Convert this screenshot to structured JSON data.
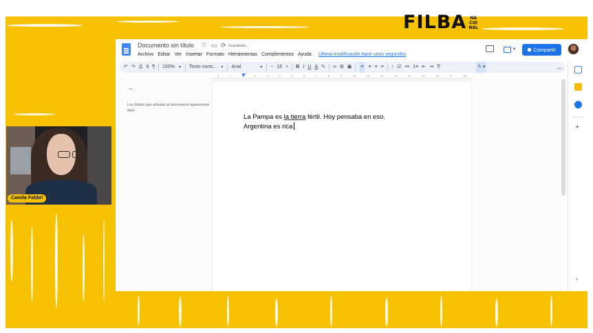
{
  "logo": {
    "main": "FILBA",
    "sub_lines": [
      "NA",
      "CIO",
      "NAL"
    ]
  },
  "docs": {
    "title": "Documento sin título",
    "saving_status": "Guardando...",
    "menu": [
      "Archivo",
      "Editar",
      "Ver",
      "Insertar",
      "Formato",
      "Herramientas",
      "Complementos",
      "Ayuda"
    ],
    "last_edit": "Última modificación hace unos segundos",
    "share_label": "Compartir",
    "toolbar": {
      "zoom": "100%",
      "style": "Texto norm...",
      "font": "Arial",
      "minus": "−",
      "font_size": "16",
      "plus": "+",
      "bold": "B",
      "italic": "I",
      "underline": "U",
      "text_color": "A"
    },
    "ruler_numbers": [
      "2",
      "1",
      "1",
      "2",
      "3",
      "4",
      "5",
      "6",
      "7",
      "8",
      "9",
      "10",
      "11",
      "12",
      "13",
      "14",
      "15",
      "16",
      "17",
      "18"
    ],
    "outline_hint": "Los títulos que añadas al documento aparecerán aquí.",
    "content": {
      "line1_before": "La Pampa es ",
      "line1_underlined": "la tierra",
      "line1_after": " fértil. Hoy pensaba en eso.",
      "line2": "Argentina es rica"
    }
  },
  "webcam": {
    "name": "Camila Fabbri"
  },
  "colors": {
    "event_yellow": "#f6c200",
    "docs_blue": "#1a73e8",
    "toolbar_bg": "#edf2fa"
  },
  "icons": [
    "star-icon",
    "folder-icon",
    "cloud-icon",
    "comment-icon",
    "present-icon",
    "lock-icon",
    "undo-icon",
    "redo-icon",
    "print-icon",
    "spellcheck-icon",
    "paint-format-icon",
    "link-icon",
    "comment-add-icon",
    "image-icon",
    "align-left-icon",
    "align-center-icon",
    "align-right-icon",
    "justify-icon",
    "line-spacing-icon",
    "checklist-icon",
    "bulleted-list-icon",
    "numbered-list-icon",
    "indent-decrease-icon",
    "indent-increase-icon",
    "clear-format-icon",
    "edit-mode-icon",
    "calendar-icon",
    "keep-icon",
    "tasks-icon",
    "add-icon",
    "expand-icon",
    "back-arrow-icon"
  ]
}
